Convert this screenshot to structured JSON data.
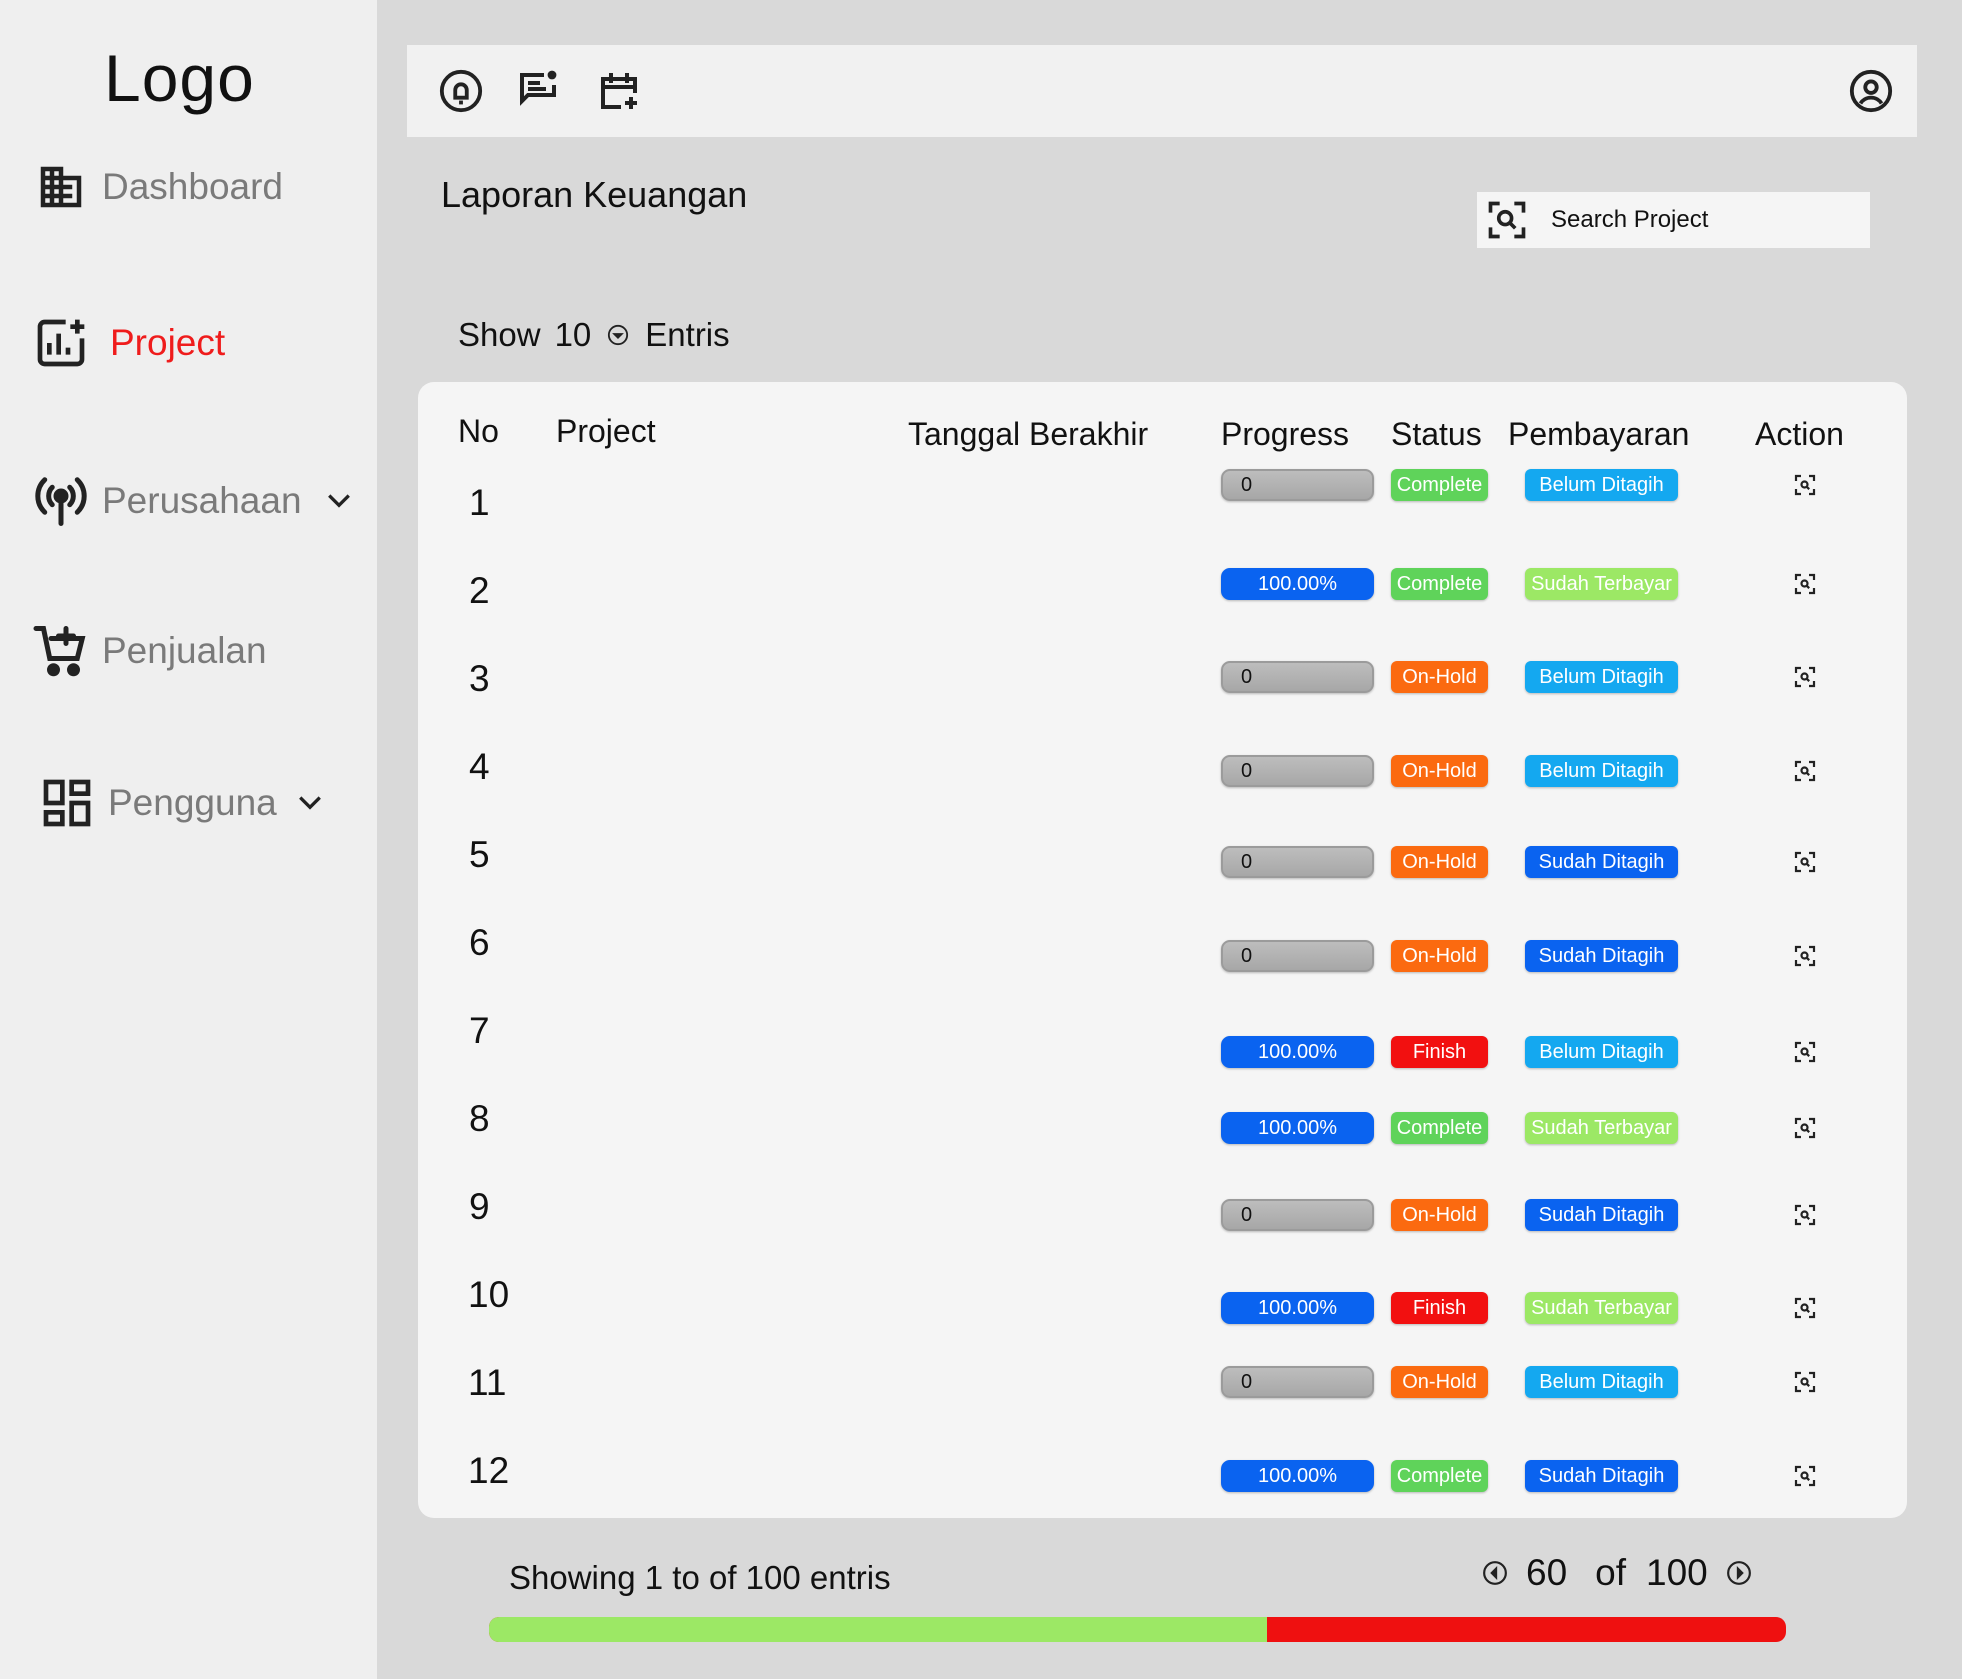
{
  "sidebar": {
    "logo": "Logo",
    "items": [
      {
        "label": "Dashboard",
        "icon": "building-icon"
      },
      {
        "label": "Project",
        "icon": "chart-add-icon",
        "active": true
      },
      {
        "label": "Perusahaan",
        "icon": "broadcast-icon",
        "has_dropdown": true
      },
      {
        "label": "Penjualan",
        "icon": "cart-add-icon"
      },
      {
        "label": "Pengguna",
        "icon": "dashboard-grid-icon",
        "has_dropdown": true
      }
    ]
  },
  "topbar": {
    "icons": [
      "notification-bell-icon",
      "message-icon",
      "calendar-add-icon",
      "user-account-icon"
    ]
  },
  "page": {
    "title": "Laporan Keuangan",
    "search_placeholder": "Search Project",
    "show_label": "Show",
    "show_value": "10",
    "entries_label": "Entris"
  },
  "table": {
    "headers": {
      "no": "No",
      "project": "Project",
      "end_date": "Tanggal Berakhir",
      "progress": "Progress",
      "status": "Status",
      "payment": "Pembayaran",
      "action": "Action"
    },
    "rows": [
      {
        "no": "1",
        "progress": "0",
        "progress_value": 0,
        "status": "Complete",
        "payment": "Belum Ditagih"
      },
      {
        "no": "2",
        "progress": "100.00%",
        "progress_value": 100,
        "status": "Complete",
        "payment": "Sudah Terbayar"
      },
      {
        "no": "3",
        "progress": "0",
        "progress_value": 0,
        "status": "On-Hold",
        "payment": "Belum Ditagih"
      },
      {
        "no": "4",
        "progress": "0",
        "progress_value": 0,
        "status": "On-Hold",
        "payment": "Belum Ditagih"
      },
      {
        "no": "5",
        "progress": "0",
        "progress_value": 0,
        "status": "On-Hold",
        "payment": "Sudah Ditagih"
      },
      {
        "no": "6",
        "progress": "0",
        "progress_value": 0,
        "status": "On-Hold",
        "payment": "Sudah Ditagih"
      },
      {
        "no": "7",
        "progress": "100.00%",
        "progress_value": 100,
        "status": "Finish",
        "payment": "Belum Ditagih"
      },
      {
        "no": "8",
        "progress": "100.00%",
        "progress_value": 100,
        "status": "Complete",
        "payment": "Sudah Terbayar"
      },
      {
        "no": "9",
        "progress": "0",
        "progress_value": 0,
        "status": "On-Hold",
        "payment": "Sudah Ditagih"
      },
      {
        "no": "10",
        "progress": "100.00%",
        "progress_value": 100,
        "status": "Finish",
        "payment": "Sudah Terbayar"
      },
      {
        "no": "11",
        "progress": "0",
        "progress_value": 0,
        "status": "On-Hold",
        "payment": "Belum Ditagih"
      },
      {
        "no": "12",
        "progress": "100.00%",
        "progress_value": 100,
        "status": "Complete",
        "payment": "Sudah Ditagih"
      }
    ]
  },
  "colors": {
    "active_nav": "#ef1c1c",
    "progress_full": "#0a63f0",
    "status": {
      "Complete": "#5fd35a",
      "On-Hold": "#fb6a10",
      "Finish": "#f21010"
    },
    "payment": {
      "Belum Ditagih": "#14a8f0",
      "Sudah Ditagih": "#0a63f0",
      "Sudah Terbayar": "#9ce865"
    },
    "page_progress_done": "#9ce865",
    "page_progress_remaining": "#ef1010"
  },
  "footer": {
    "showing_text": "Showing 1 to of 100 entris",
    "current": "60",
    "of_label": "of",
    "total": "100",
    "progress_fraction": 0.6
  }
}
